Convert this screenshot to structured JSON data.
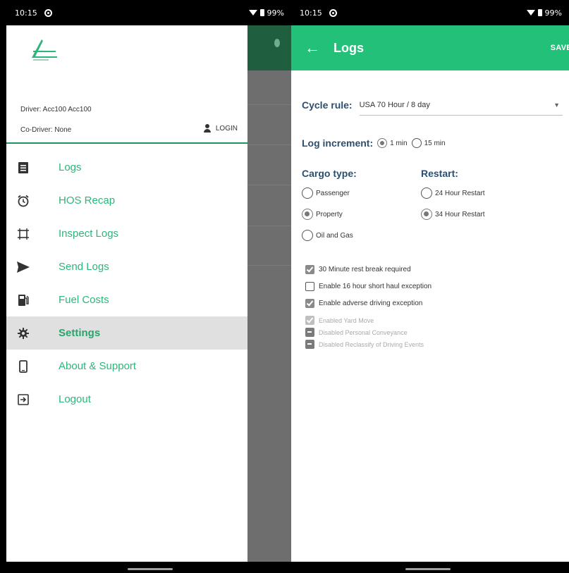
{
  "left": {
    "status": {
      "time": "10:15",
      "battery": "99%"
    },
    "driver": "Driver: Acc100 Acc100",
    "codriver": "Co-Driver: None",
    "login_label": "LOGIN",
    "menu": [
      {
        "label": "Logs",
        "icon": "list-icon"
      },
      {
        "label": "HOS Recap",
        "icon": "alarm-icon"
      },
      {
        "label": "Inspect Logs",
        "icon": "inspect-icon"
      },
      {
        "label": "Send Logs",
        "icon": "send-icon"
      },
      {
        "label": "Fuel Costs",
        "icon": "fuel-icon"
      },
      {
        "label": "Settings",
        "icon": "gear-icon",
        "active": true
      },
      {
        "label": "About & Support",
        "icon": "phone-icon"
      },
      {
        "label": "Logout",
        "icon": "exit-icon"
      }
    ],
    "brand_color": "#2db67b"
  },
  "right": {
    "status": {
      "time": "10:15",
      "battery": "99%"
    },
    "title": "Logs",
    "save_label": "SAVE",
    "cycle_rule_label": "Cycle rule:",
    "cycle_rule_value": "USA 70 Hour / 8 day",
    "log_increment_label": "Log increment:",
    "increment_options": [
      {
        "label": "1 min",
        "checked": true
      },
      {
        "label": "15 min",
        "checked": false
      }
    ],
    "cargo_type_label": "Cargo type:",
    "cargo_options": [
      {
        "label": "Passenger",
        "checked": false
      },
      {
        "label": "Property",
        "checked": true
      },
      {
        "label": "Oil and Gas",
        "checked": false
      }
    ],
    "restart_label": "Restart:",
    "restart_options": [
      {
        "label": "24 Hour Restart",
        "checked": false
      },
      {
        "label": "34 Hour Restart",
        "checked": true
      }
    ],
    "checks": [
      {
        "label": "30 Minute rest break required",
        "state": "checked"
      },
      {
        "label": "Enable 16 hour short haul exception",
        "state": "unchecked"
      },
      {
        "label": "Enable adverse driving exception",
        "state": "checked"
      }
    ],
    "disabled_checks": [
      {
        "label": "Enabled Yard Move",
        "state": "light"
      },
      {
        "label": "Disabled Personal Conveyance",
        "state": "dash"
      },
      {
        "label": "Disabled Reclassify of Driving Events",
        "state": "dash"
      }
    ],
    "app_bar_color": "#23c07a"
  }
}
